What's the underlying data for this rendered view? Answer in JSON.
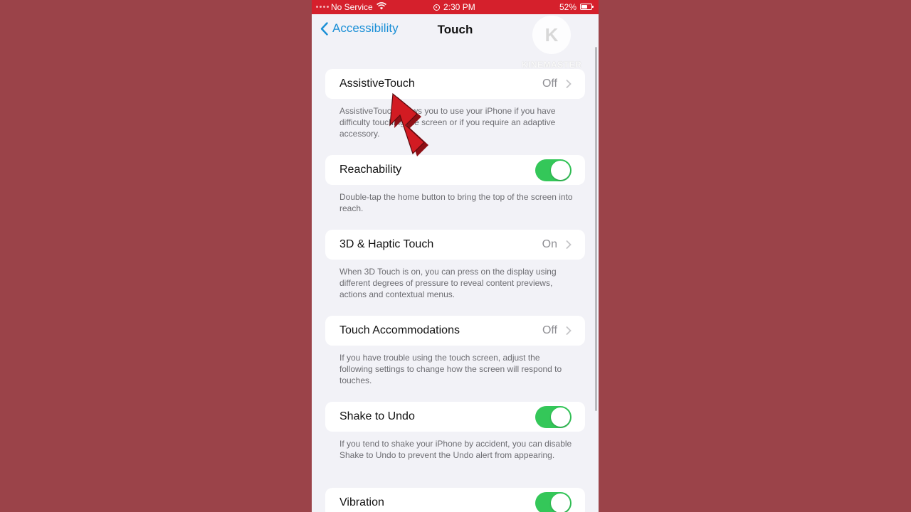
{
  "status_bar": {
    "carrier": "No Service",
    "time": "2:30 PM",
    "battery_percent": "52%",
    "battery_level": 0.52
  },
  "nav": {
    "back_label": "Accessibility",
    "title": "Touch"
  },
  "watermark": {
    "logo_letter": "K",
    "text": "KINEMASTER"
  },
  "settings": [
    {
      "label": "AssistiveTouch",
      "value": "Off",
      "control": "disclosure",
      "footer": "AssistiveTouch allows you to use your iPhone if you have difficulty touching the screen or if you require an adaptive accessory."
    },
    {
      "label": "Reachability",
      "control": "toggle",
      "on": true,
      "footer": "Double-tap the home button to bring the top of the screen into reach."
    },
    {
      "label": "3D & Haptic Touch",
      "value": "On",
      "control": "disclosure",
      "footer": "When 3D Touch is on, you can press on the display using different degrees of pressure to reveal content previews, actions and contextual menus."
    },
    {
      "label": "Touch Accommodations",
      "value": "Off",
      "control": "disclosure",
      "footer": "If you have trouble using the touch screen, adjust the following settings to change how the screen will respond to touches."
    },
    {
      "label": "Shake to Undo",
      "control": "toggle",
      "on": true,
      "footer": "If you tend to shake your iPhone by accident, you can disable Shake to Undo to prevent the Undo alert from appearing."
    },
    {
      "label": "Vibration",
      "control": "toggle",
      "on": true
    }
  ],
  "colors": {
    "accent": "#1a8fd6",
    "toggle_on": "#34c759",
    "status_bar": "#d5202c",
    "background": "#9b4349",
    "arrow": "#d21b22"
  }
}
